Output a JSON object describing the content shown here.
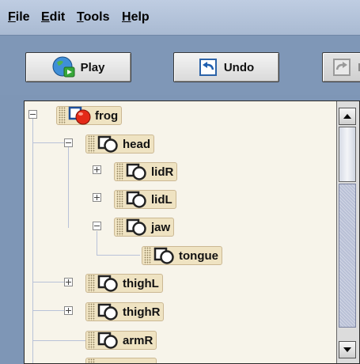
{
  "menu": [
    {
      "label": "File",
      "key": "F",
      "rest": "ile"
    },
    {
      "label": "Edit",
      "key": "E",
      "rest": "dit"
    },
    {
      "label": "Tools",
      "key": "T",
      "rest": "ools"
    },
    {
      "label": "Help",
      "key": "H",
      "rest": "elp"
    }
  ],
  "toolbar": {
    "play_label": "Play",
    "undo_label": "Undo",
    "redo_label": "R"
  },
  "tree": {
    "nodes": [
      {
        "label": "frog",
        "icon": "frog-object-icon",
        "expander": "minus"
      },
      {
        "label": "head",
        "icon": "part-icon",
        "expander": "minus"
      },
      {
        "label": "lidR",
        "icon": "part-icon",
        "expander": "plus"
      },
      {
        "label": "lidL",
        "icon": "part-icon",
        "expander": "plus"
      },
      {
        "label": "jaw",
        "icon": "part-icon",
        "expander": "minus"
      },
      {
        "label": "tongue",
        "icon": "part-icon",
        "expander": "none"
      },
      {
        "label": "thighL",
        "icon": "part-icon",
        "expander": "plus"
      },
      {
        "label": "thighR",
        "icon": "part-icon",
        "expander": "plus"
      },
      {
        "label": "armR",
        "icon": "part-icon",
        "expander": "none"
      }
    ]
  },
  "colors": {
    "background": "#7e96b6",
    "panel": "#f7f4ea",
    "node_fill": "#efe3c2"
  }
}
